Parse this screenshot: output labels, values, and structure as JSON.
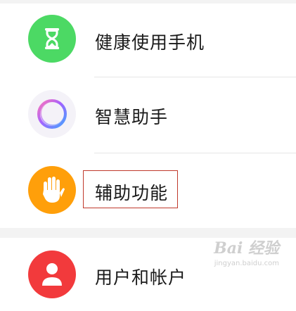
{
  "settings_list": {
    "items": [
      {
        "label": "健康使用手机",
        "icon": "hourglass-icon",
        "icon_bg": "#4cd964"
      },
      {
        "label": "智慧助手",
        "icon": "assistant-ring-icon",
        "icon_bg": "#f4f2f8"
      },
      {
        "label": "辅助功能",
        "icon": "hand-icon",
        "icon_bg": "#ff9f0a"
      },
      {
        "label": "用户和帐户",
        "icon": "user-icon",
        "icon_bg": "#f23a3c"
      }
    ],
    "highlight_color": "#c0392b"
  },
  "watermark": {
    "main": "Bai 经验",
    "sub": "jingyan.baidu.com"
  }
}
